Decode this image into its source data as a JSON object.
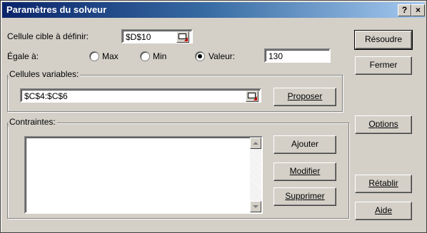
{
  "window": {
    "title": "Paramètres du solveur",
    "help_label": "?",
    "close_label": "×"
  },
  "target": {
    "label": "Cellule cible à définir:",
    "value": "$D$10"
  },
  "equal": {
    "label": "Égale à:",
    "max": "Max",
    "min": "Min",
    "value_label": "Valeur:",
    "value": "130",
    "selected": "value"
  },
  "variables": {
    "label": "Cellules variables:",
    "value": "$C$4:$C$6",
    "propose": "Proposer"
  },
  "constraints": {
    "label": "Contraintes:",
    "items": [],
    "add": "Ajouter",
    "modify": "Modifier",
    "delete": "Supprimer"
  },
  "buttons": {
    "solve": "Résoudre",
    "close": "Fermer",
    "options": "Options",
    "reset": "Rétablir",
    "help": "Aide"
  }
}
